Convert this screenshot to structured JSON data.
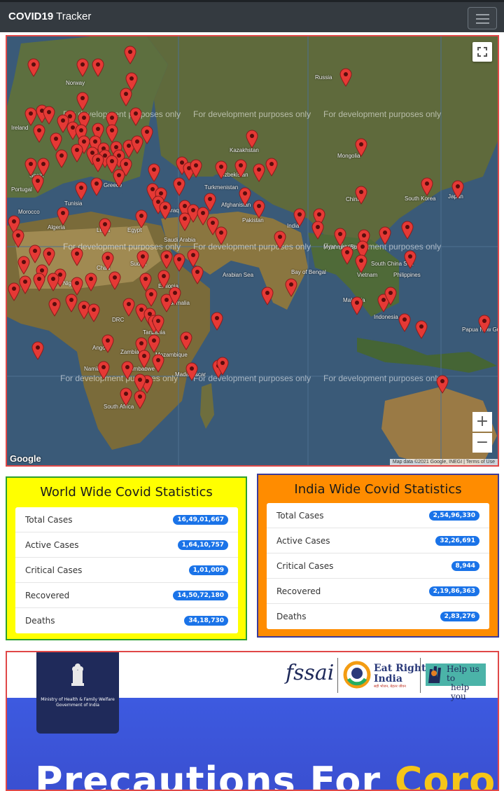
{
  "navbar": {
    "brand_bold": "COVID19",
    "brand_rest": "Tracker"
  },
  "map": {
    "watermark": "For development purposes only",
    "places": {
      "norway": "Norway",
      "ireland": "Ireland",
      "russia": "Russia",
      "kazakhstan": "Kazakhstan",
      "mongolia": "Mongolia",
      "uzbekistan": "Uzbekistan",
      "turkmenistan": "Turkmenistan",
      "afghanistan": "Afghanistan",
      "pakistan": "Pakistan",
      "china": "China",
      "south_korea": "South Korea",
      "japan": "Japan",
      "india": "India",
      "saudi_arabia": "Saudi Arabia",
      "iraq": "Iraq",
      "egypt": "Egypt",
      "libya": "Libya",
      "algeria": "Algeria",
      "morocco": "Morocco",
      "sudan": "Sudan",
      "chad": "Chad",
      "niger": "Niger",
      "ethiopia": "Ethiopia",
      "somalia": "Somalia",
      "drc": "DRC",
      "tanzania": "Tanzania",
      "angola": "Angola",
      "zambia": "Zambia",
      "namibia": "Namibia",
      "zimbabwe": "Zimbabwe",
      "mozambique": "Mozambique",
      "madagascar": "Madagascar",
      "south_africa": "South Africa",
      "philippines": "Philippines",
      "vietnam": "Vietnam",
      "thailand": "Thailand",
      "malaysia": "Malaysia",
      "indonesia": "Indonesia",
      "papua": "Papua New Guinea",
      "greece": "Greece",
      "spain": "Spain",
      "portugal": "Portugal",
      "tunisia": "Tunisia",
      "arabian_sea": "Arabian Sea",
      "bay_of_bengal": "Bay of Bengal",
      "south_china_sea": "South China Sea",
      "myanmar": "Myanmar (Burma)"
    },
    "zoom_in": "+",
    "zoom_out": "−",
    "google_logo": "Google",
    "attribution": "Map data ©2021 Google, INEGI  |  Terms of Use"
  },
  "world": {
    "title": "World Wide Covid Statistics",
    "rows": [
      {
        "label": "Total Cases",
        "value": "16,49,01,667"
      },
      {
        "label": "Active Cases",
        "value": "1,64,10,757"
      },
      {
        "label": "Critical Cases",
        "value": "1,01,009"
      },
      {
        "label": "Recovered",
        "value": "14,50,72,180"
      },
      {
        "label": "Deaths",
        "value": "34,18,730"
      }
    ]
  },
  "india": {
    "title": "India Wide Covid Statistics",
    "rows": [
      {
        "label": "Total Cases",
        "value": "2,54,96,330"
      },
      {
        "label": "Active Cases",
        "value": "32,26,691"
      },
      {
        "label": "Critical Cases",
        "value": "8,944"
      },
      {
        "label": "Recovered",
        "value": "2,19,86,363"
      },
      {
        "label": "Deaths",
        "value": "2,83,276"
      }
    ]
  },
  "banner": {
    "ministry_line1": "Ministry of Health & Family Welfare",
    "ministry_line2": "Government of India",
    "fssai": "fssai",
    "eat_right_1": "Eat Right",
    "eat_right_2": "India",
    "eat_right_3": "सही भोजन, बेहतर जीवन",
    "help_1": "Help us to",
    "help_2": "help you",
    "headline_1": "Precautions For",
    "headline_2": "Coronavirus"
  },
  "colors": {
    "world_panel_bg": "#ffff00",
    "world_panel_border": "#2ea02e",
    "india_panel_bg": "#ff8c00",
    "india_panel_border": "#3b3b9a",
    "badge": "#1a73e8",
    "pin": "#e53935"
  }
}
